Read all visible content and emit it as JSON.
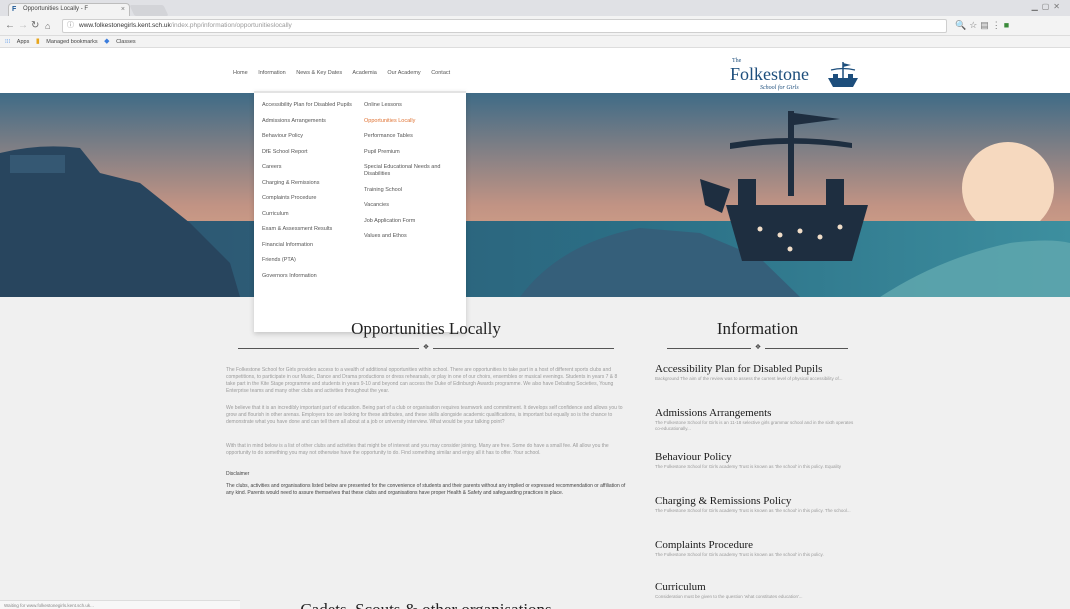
{
  "browser": {
    "tab_title": "Opportunities Locally - F",
    "url_host": "www.folkestonegirls.kent.sch.uk",
    "url_path": "/index.php/information/opportunitieslocally",
    "bookmarks": [
      "Apps",
      "Managed bookmarks",
      "Classes"
    ]
  },
  "site": {
    "nav": [
      "Home",
      "Information",
      "News & Key Dates",
      "Academia",
      "Our Academy",
      "Contact"
    ],
    "logo": {
      "the": "The",
      "name": "Folkestone",
      "sub": "School for Girls"
    }
  },
  "menu": {
    "col1": [
      "Accessibility Plan for Disabled Pupils",
      "Admissions Arrangements",
      "Behaviour Policy",
      "DfE School Report",
      "Careers",
      "Charging & Remissions",
      "Complaints Procedure",
      "Curriculum",
      "Exam & Assessment Results",
      "Financial Information",
      "Friends (PTA)",
      "Governors Information"
    ],
    "col2": [
      "Online Lessons",
      "Opportunities Locally",
      "Performance Tables",
      "Pupil Premium",
      "Special Educational Needs and Disabilities",
      "Training School",
      "Vacancies",
      "Job Application Form",
      "Values and Ethos"
    ],
    "active": "Opportunities Locally"
  },
  "main": {
    "title": "Opportunities Locally",
    "p1": "The Folkestone School for Girls provides access to a wealth of additional opportunities within school. There are opportunities to take part in a host of different sports clubs and competitions, to participate in our Music, Dance and Drama productions or dress rehearsals, or play in one of our choirs, ensembles or musical evenings. Students in years 7 & 8 take part in the Kite Stage programme and students in years 9-10 and beyond can access the Duke of Edinburgh Awards programme. We also have Debating Societies, Young Enterprise teams and many other clubs and activities throughout the year.",
    "p2": "We believe that it is an incredibly important part of education. Being part of a club or organisation requires teamwork and commitment. It develops self confidence and allows you to grow and flourish in other arenas. Employers too are looking for these attributes, and these skills alongside academic qualifications, is important but equally so is the chance to demonstrate what you have done and can tell them all about at a job or university interview. What would be your talking point?",
    "p3": "With that in mind below is a list of other clubs and activities that might be of interest and you may consider joining. Many are free. Some do have a small fee. All allow you the opportunity to do something you may not otherwise have the opportunity to do. Find something similar and enjoy all it has to offer. Your school.",
    "disclaimer_label": "Disclaimer",
    "disclaimer": "The clubs, activities and organisations listed below are presented for the convenience of students and their parents without any implied or expressed recommendation or affiliation of any kind. Parents would need to assure themselves that these clubs and organisations have proper Health & Safety and safeguarding practices in place.",
    "cadets_title": "Cadets, Scouts & other organisations"
  },
  "sidebar": {
    "title": "Information",
    "items": [
      {
        "title": "Accessibility Plan for Disabled Pupils",
        "desc": "Background The aim of the review was to assess the current level of physical accessibility of..."
      },
      {
        "title": "Admissions Arrangements",
        "desc": "The Folkestone School for Girls is an 11-18 selective girls grammar school and in the sixth operates co-educationally..."
      },
      {
        "title": "Behaviour Policy",
        "desc": "The Folkestone School for Girls academy Trust is known as 'the school' in this policy. Equality"
      },
      {
        "title": "Charging & Remissions Policy",
        "desc": "The Folkestone School for Girls academy Trust is known as 'the school' in this policy. The school..."
      },
      {
        "title": "Complaints Procedure",
        "desc": "The Folkestone School for Girls academy Trust is known as 'the school' in this policy."
      },
      {
        "title": "Curriculum",
        "desc": "Consideration must be given to the question 'what constitutes education'..."
      }
    ]
  },
  "status_text": "Waiting for www.folkestonegirls.kent.sch.uk..."
}
